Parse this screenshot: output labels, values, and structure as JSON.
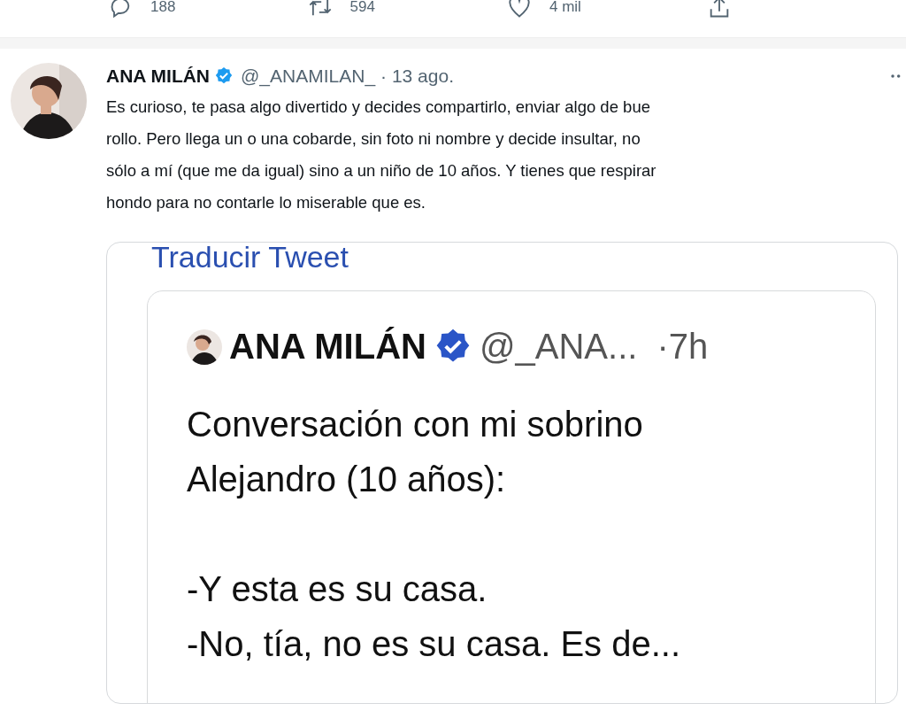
{
  "actions": [
    {
      "kind": "reply",
      "count": "188"
    },
    {
      "kind": "retweet",
      "count": "594"
    },
    {
      "kind": "like",
      "count": "4 mil"
    },
    {
      "kind": "share"
    }
  ],
  "tweet": {
    "name": "ANA MILÁN",
    "verified": true,
    "handle": "@_ANAMILAN_",
    "time": "· 13 ago.",
    "text": "Es curioso, te pasa algo divertido y decides compartirlo, enviar algo de bue\nrollo. Pero llega un o una cobarde, sin foto ni nombre y decide insultar, no\nsólo a mí (que me da igual) sino a un niño de 10 años. Y tienes que respirar\nhondo para no contarle lo miserable que es.",
    "media": {
      "translate": "Traducir Tweet",
      "quoted": {
        "name": "ANA MILÁN",
        "verified": true,
        "handle": "@_ANA...",
        "time": "·7h",
        "paragraphs": [
          [
            "Conversación con mi sobrino",
            "Alejandro (10 años):"
          ],
          [
            "-Y esta es su casa.",
            "-No, tía, no es su casa. Es de..."
          ]
        ]
      }
    }
  }
}
